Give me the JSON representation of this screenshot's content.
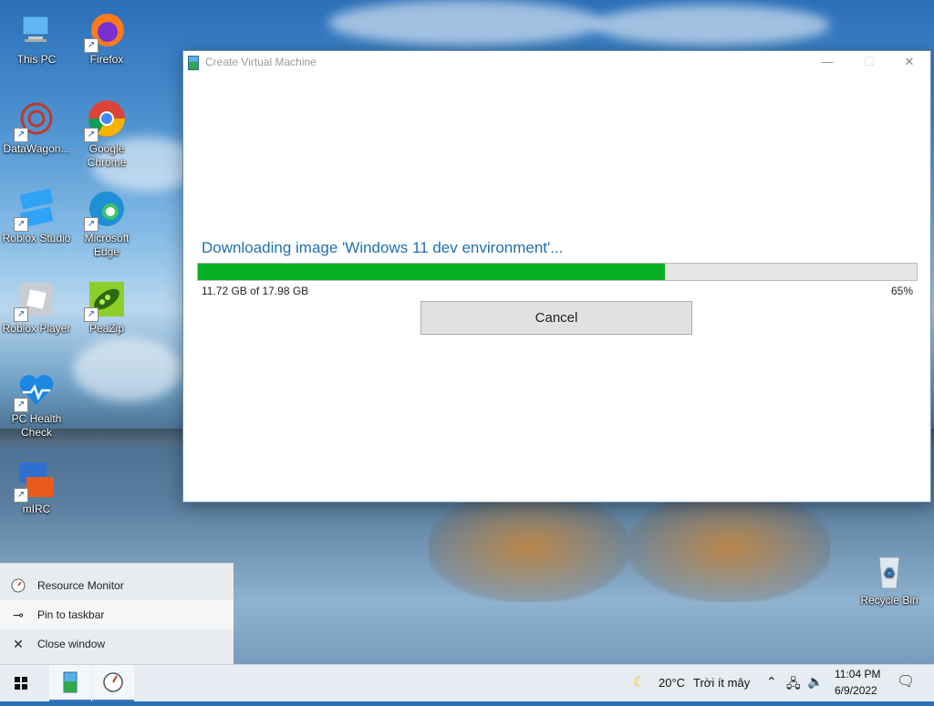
{
  "desktop": {
    "icons": [
      {
        "label": "This PC"
      },
      {
        "label": "Firefox"
      },
      {
        "label": "DataWagon..."
      },
      {
        "label": "Google Chrome"
      },
      {
        "label": "Roblox Studio"
      },
      {
        "label": "Microsoft Edge"
      },
      {
        "label": "Roblox Player"
      },
      {
        "label": "PeaZip"
      },
      {
        "label": "PC Health Check"
      },
      {
        "label": "mIRC"
      },
      {
        "label": "Recycle Bin"
      }
    ]
  },
  "window": {
    "title": "Create Virtual Machine",
    "minimize": "—",
    "maximize": "☐",
    "close": "✕",
    "headline": "Downloading image 'Windows 11 dev environment'...",
    "progress_fraction": 0.65,
    "progress_detail": "11.72 GB of 17.98 GB",
    "progress_percent": "65%",
    "cancel_label": "Cancel"
  },
  "jumplist": {
    "items": [
      {
        "label": "Resource Monitor",
        "icon": "resource-monitor-icon"
      },
      {
        "label": "Pin to taskbar",
        "icon": "pin-icon"
      },
      {
        "label": "Close window",
        "icon": "close-icon"
      }
    ]
  },
  "taskbar": {
    "weather_temp": "20°C",
    "weather_text": "Trời ít mây",
    "time": "11:04 PM",
    "date": "6/9/2022"
  },
  "colors": {
    "progress_fill": "#06b025",
    "headline": "#1f6fb5",
    "taskbar": "#e6ecf1"
  }
}
